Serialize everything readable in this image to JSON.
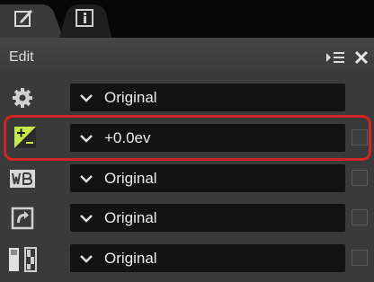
{
  "tabs": [
    {
      "name": "edit-tab",
      "icon": "pencil-edit-icon",
      "active": true
    },
    {
      "name": "info-tab",
      "icon": "info-icon",
      "active": false
    }
  ],
  "header": {
    "title": "Edit",
    "menu_icon": "panel-menu-icon",
    "close_icon": "close-icon"
  },
  "rows": [
    {
      "icon": "gear-icon",
      "value": "Original",
      "has_checkbox": false
    },
    {
      "icon": "exposure-compensation-icon",
      "value": "+0.0ev",
      "has_checkbox": true
    },
    {
      "icon": "white-balance-icon",
      "value": "Original",
      "has_checkbox": true
    },
    {
      "icon": "picture-control-icon",
      "value": "Original",
      "has_checkbox": true
    },
    {
      "icon": "tone-adjust-icon",
      "value": "Original",
      "has_checkbox": true
    }
  ],
  "colors": {
    "highlight": "#d42323",
    "accent": "#c8e84a",
    "panel": "#3a3a3a",
    "field": "#131313"
  }
}
